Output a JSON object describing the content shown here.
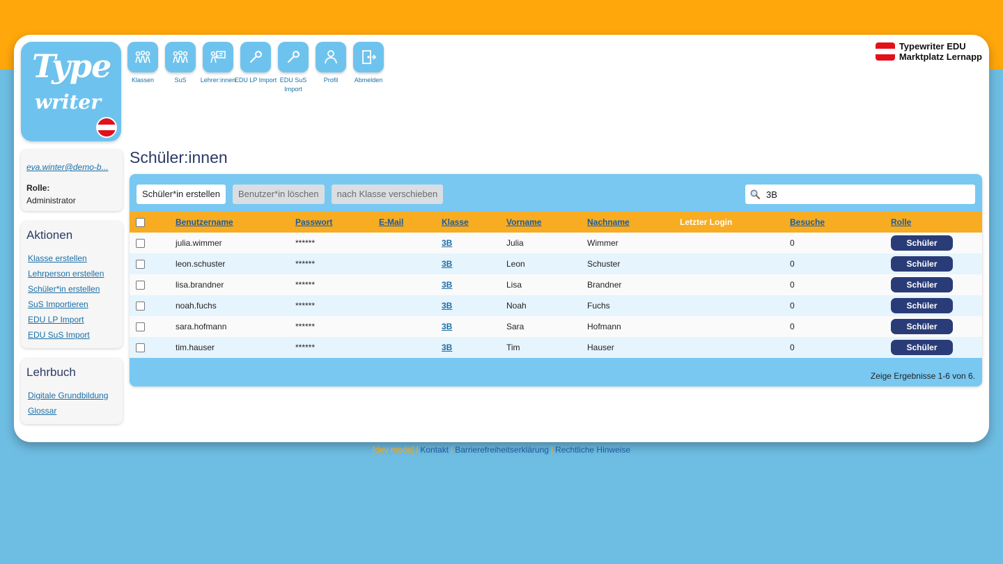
{
  "brand": {
    "line1": "Typewriter EDU",
    "line2": "Marktplatz Lernapp",
    "flag_colors": [
      "#e3101a",
      "#ffffff",
      "#e3101a"
    ]
  },
  "logo": {
    "line1": "Type",
    "line2": "writer"
  },
  "nav": [
    {
      "label": "Klassen",
      "icon": "group-icon"
    },
    {
      "label": "SuS",
      "icon": "students-icon"
    },
    {
      "label": "Lehrer:innen",
      "icon": "teacher-icon"
    },
    {
      "label": "EDU LP Import",
      "icon": "wrench-icon"
    },
    {
      "label": "EDU SuS Import",
      "icon": "wrench-icon"
    },
    {
      "label": "Profil",
      "icon": "person-icon"
    },
    {
      "label": "Abmelden",
      "icon": "logout-door-icon"
    }
  ],
  "user": {
    "email": "eva.winter@demo-b...",
    "role_label": "Rolle:",
    "role_value": "Administrator"
  },
  "actions": {
    "title": "Aktionen",
    "links": [
      "Klasse erstellen",
      "Lehrperson erstellen",
      "Schüler*in erstellen",
      "SuS Importieren",
      "EDU LP Import",
      "EDU SuS Import"
    ]
  },
  "book": {
    "title": "Lehrbuch",
    "links": [
      "Digitale Grundbildung",
      "Glossar"
    ]
  },
  "main": {
    "title": "Schüler:innen",
    "buttons": {
      "create": "Schüler*in erstellen",
      "delete": "Benutzer*in löschen",
      "move": "nach Klasse verschieben"
    },
    "search_value": "3B",
    "columns": [
      "Benutzername",
      "Passwort",
      "E-Mail",
      "Klasse",
      "Vorname",
      "Nachname",
      "Letzter Login",
      "Besuche",
      "Rolle"
    ],
    "rows": [
      {
        "username": "julia.wimmer",
        "password": "******",
        "email": "",
        "klasse": "3B",
        "vorname": "Julia",
        "nachname": "Wimmer",
        "last_login": "",
        "besuche": "0",
        "rolle": "Schüler"
      },
      {
        "username": "leon.schuster",
        "password": "******",
        "email": "",
        "klasse": "3B",
        "vorname": "Leon",
        "nachname": "Schuster",
        "last_login": "",
        "besuche": "0",
        "rolle": "Schüler"
      },
      {
        "username": "lisa.brandner",
        "password": "******",
        "email": "",
        "klasse": "3B",
        "vorname": "Lisa",
        "nachname": "Brandner",
        "last_login": "",
        "besuche": "0",
        "rolle": "Schüler"
      },
      {
        "username": "noah.fuchs",
        "password": "******",
        "email": "",
        "klasse": "3B",
        "vorname": "Noah",
        "nachname": "Fuchs",
        "last_login": "",
        "besuche": "0",
        "rolle": "Schüler"
      },
      {
        "username": "sara.hofmann",
        "password": "******",
        "email": "",
        "klasse": "3B",
        "vorname": "Sara",
        "nachname": "Hofmann",
        "last_login": "",
        "besuche": "0",
        "rolle": "Schüler"
      },
      {
        "username": "tim.hauser",
        "password": "******",
        "email": "",
        "klasse": "3B",
        "vorname": "Tim",
        "nachname": "Hauser",
        "last_login": "",
        "besuche": "0",
        "rolle": "Schüler"
      }
    ],
    "results_text": "Zeige Ergebnisse 1-6 von 6."
  },
  "footer": {
    "tag": "[dev mode]",
    "links": [
      "Kontakt",
      "Barrierefreiheitserklärung",
      "Rechtliche Hinweise"
    ]
  },
  "colors": {
    "background": "#6ebde3",
    "top_band": "#ffa70b",
    "header_row": "#f7ac22",
    "role_button": "#2a3c78",
    "link": "#1a6fa6"
  }
}
